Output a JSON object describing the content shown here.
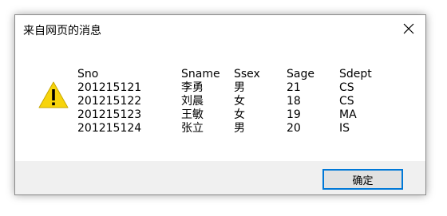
{
  "dialog": {
    "title": "来自网页的消息",
    "ok_label": "确定",
    "icon": "warning-icon"
  },
  "message": {
    "header": [
      "Sno",
      "Sname",
      "Ssex",
      "Sage",
      "Sdept"
    ],
    "rows": [
      [
        "201215121",
        "李勇",
        "男",
        "21",
        "CS"
      ],
      [
        "201215122",
        "刘晨",
        "女",
        "18",
        "CS"
      ],
      [
        "201215123",
        "王敏",
        "女",
        "19",
        "MA"
      ],
      [
        "201215124",
        "张立",
        "男",
        "20",
        "IS"
      ]
    ]
  },
  "colors": {
    "accent": "#0078d7",
    "warning_fill": "#f7d40c",
    "footer_bg": "#f0f0f0"
  }
}
